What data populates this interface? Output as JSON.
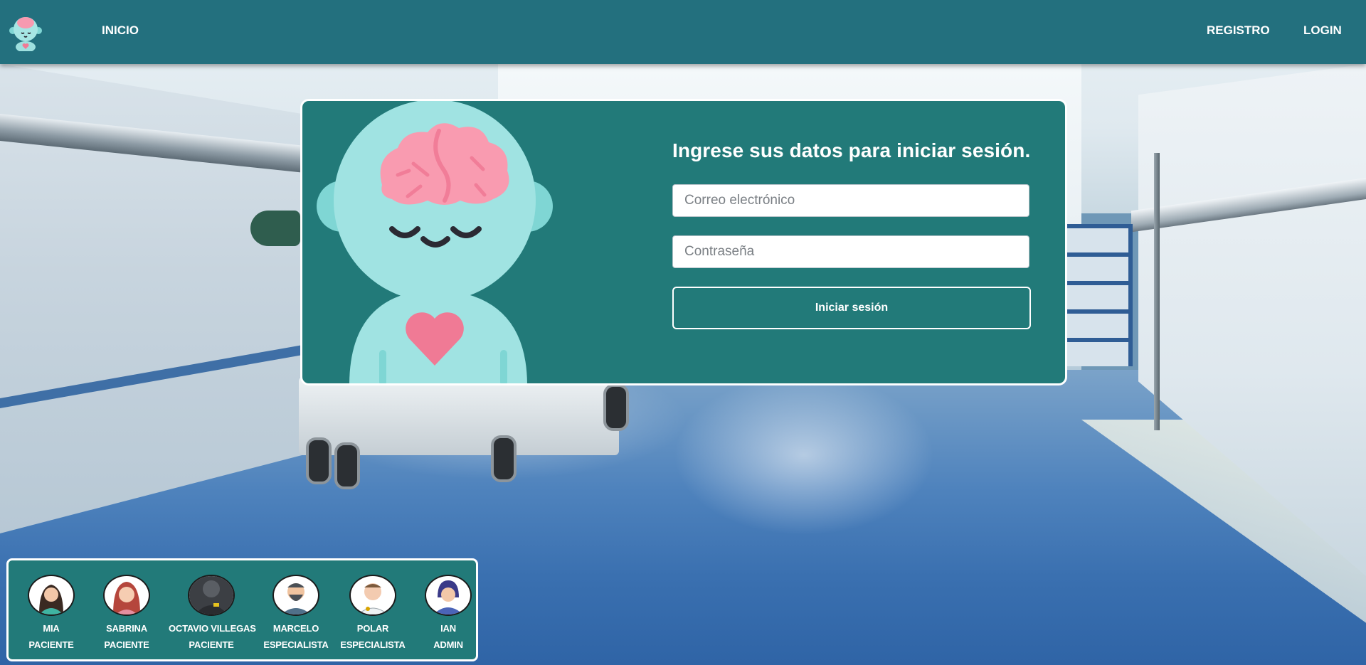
{
  "nav": {
    "logo_icon": "brain-mascot-icon",
    "inicio": "INICIO",
    "registro": "REGISTRO",
    "login": "LOGIN"
  },
  "login": {
    "title": "Ingrese sus datos para iniciar sesión.",
    "email_placeholder": "Correo electrónico",
    "password_placeholder": "Contraseña",
    "submit_label": "Iniciar sesión"
  },
  "quick_users": [
    {
      "name": "MIA",
      "role": "PACIENTE"
    },
    {
      "name": "SABRINA",
      "role": "PACIENTE"
    },
    {
      "name": "OCTAVIO VILLEGAS",
      "role": "PACIENTE"
    },
    {
      "name": "MARCELO",
      "role": "ESPECIALISTA"
    },
    {
      "name": "POLAR",
      "role": "ESPECIALISTA"
    },
    {
      "name": "IAN",
      "role": "ADMIN"
    }
  ],
  "colors": {
    "header": "#23707e",
    "card": "#227a79",
    "mascot_face": "#a0e3e2",
    "brain": "#f99bb0",
    "heart": "#f07a95"
  }
}
